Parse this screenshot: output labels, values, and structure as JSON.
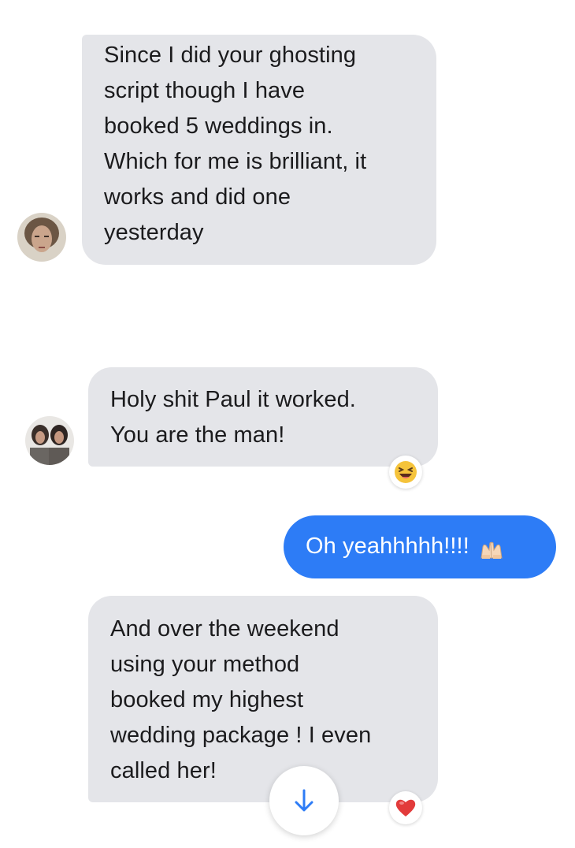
{
  "messages": [
    {
      "sender": "contact_1",
      "direction": "incoming",
      "lines": [
        "Since I did your ghosting",
        "script though I have",
        "booked 5 weddings in.",
        "Which for me is brilliant, it",
        "works and did one",
        "yesterday"
      ]
    },
    {
      "sender": "contact_2",
      "direction": "incoming",
      "lines": [
        "Holy shit Paul it worked.",
        "You are the man!"
      ],
      "reaction": "laughing-emoji"
    },
    {
      "sender": "me",
      "direction": "outgoing",
      "text": "Oh yeahhhhh!!!!",
      "emoji": "raising-hands-emoji"
    },
    {
      "sender": "contact_2",
      "direction": "incoming",
      "lines": [
        "And over the weekend",
        "using your method",
        "booked my highest",
        "wedding package ! I even",
        "called her!"
      ],
      "reaction": "heart-emoji"
    }
  ],
  "colors": {
    "incoming_bubble": "#e4e5e9",
    "outgoing_bubble": "#2d7cf6",
    "scroll_arrow": "#2d7cf6"
  },
  "controls": {
    "scroll_down_icon": "arrow-down-icon"
  }
}
